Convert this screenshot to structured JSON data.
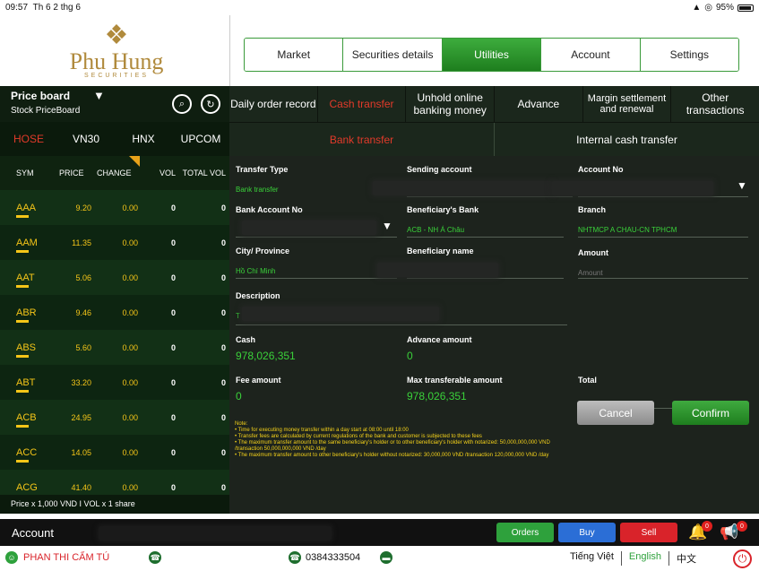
{
  "status_bar": {
    "time": "09:57",
    "date": "Th 6 2 thg 6",
    "battery": "95%"
  },
  "logo": {
    "name": "Phu Hung",
    "tagline": "SECURITIES"
  },
  "top_nav": [
    "Market",
    "Securities details",
    "Utilities",
    "Account",
    "Settings"
  ],
  "price_board": {
    "title": "Price board",
    "subtitle": "Stock PriceBoard",
    "exchanges": [
      "HOSE",
      "VN30",
      "HNX",
      "UPCOM"
    ],
    "columns": [
      "SYM",
      "PRICE",
      "CHANGE",
      "VOL",
      "TOTAL VOL"
    ],
    "rows": [
      {
        "sym": "AAA",
        "price": "9.20",
        "change": "0.00",
        "vol": "0",
        "total": "0"
      },
      {
        "sym": "AAM",
        "price": "11.35",
        "change": "0.00",
        "vol": "0",
        "total": "0"
      },
      {
        "sym": "AAT",
        "price": "5.06",
        "change": "0.00",
        "vol": "0",
        "total": "0"
      },
      {
        "sym": "ABR",
        "price": "9.46",
        "change": "0.00",
        "vol": "0",
        "total": "0"
      },
      {
        "sym": "ABS",
        "price": "5.60",
        "change": "0.00",
        "vol": "0",
        "total": "0"
      },
      {
        "sym": "ABT",
        "price": "33.20",
        "change": "0.00",
        "vol": "0",
        "total": "0"
      },
      {
        "sym": "ACB",
        "price": "24.95",
        "change": "0.00",
        "vol": "0",
        "total": "0"
      },
      {
        "sym": "ACC",
        "price": "14.05",
        "change": "0.00",
        "vol": "0",
        "total": "0"
      },
      {
        "sym": "ACG",
        "price": "41.40",
        "change": "0.00",
        "vol": "0",
        "total": "0"
      }
    ],
    "footer": "Price x 1,000 VND I VOL x 1 share"
  },
  "utility_tabs": [
    {
      "label": "Daily order record",
      "active": false
    },
    {
      "label": "Cash transfer",
      "active": true
    },
    {
      "label": "Unhold online banking money",
      "active": false
    },
    {
      "label": "Advance",
      "active": false
    },
    {
      "label": "Margin settlement and renewal",
      "active": false
    },
    {
      "label": "Other transactions",
      "active": false
    }
  ],
  "transfer_tabs": [
    "Bank transfer",
    "Internal cash transfer"
  ],
  "form": {
    "transfer_type": {
      "label": "Transfer Type",
      "value": "Bank transfer"
    },
    "sending_account": {
      "label": "Sending account"
    },
    "account_no": {
      "label": "Account No"
    },
    "bank_account_no": {
      "label": "Bank Account No"
    },
    "beneficiary_bank": {
      "label": "Beneficiary's Bank",
      "value": "ACB - NH Á Châu"
    },
    "branch": {
      "label": "Branch",
      "value": "NHTMCP A CHAU-CN TPHCM"
    },
    "city": {
      "label": "City/ Province",
      "value": "Hồ Chí Minh"
    },
    "beneficiary_name": {
      "label": "Beneficiary name"
    },
    "amount": {
      "label": "Amount",
      "placeholder": "Amount"
    },
    "description": {
      "label": "Description",
      "value": "T"
    },
    "cash": {
      "label": "Cash",
      "value": "978,026,351"
    },
    "advance_amount": {
      "label": "Advance amount",
      "value": "0"
    },
    "fee_amount": {
      "label": "Fee amount",
      "value": "0"
    },
    "max_transferable": {
      "label": "Max transferable amount",
      "value": "978,026,351"
    },
    "total": {
      "label": "Total"
    }
  },
  "notes": [
    "Note:",
    "• Time for executing money transfer within a day start at 08:00 until 18:00",
    "• Transfer fees are calculated by current regulations of the bank and customer is subjected to these fees",
    "• The maximum transfer amount to the same beneficiary's holder or to other beneficiary's holder with notarized: 50,000,000,000 VND /transaction 50,000,000,000 VND /day",
    "• The maximum transfer amount to other beneficiary's holder without notarized: 30,000,000 VND /transaction 120,000,000 VND /day"
  ],
  "buttons": {
    "cancel": "Cancel",
    "confirm": "Confirm"
  },
  "account_bar": {
    "label": "Account",
    "orders": "Orders",
    "buy": "Buy",
    "sell": "Sell",
    "notification_count": "0",
    "announcement_count": "0"
  },
  "footer": {
    "user_name": "PHAN THI CẨM TÚ",
    "phone": "0384333504",
    "languages": [
      "Tiếng Việt",
      "English",
      "中文"
    ],
    "active_language": "English"
  },
  "colors": {
    "accent_green": "#2ea13c",
    "active_red": "#e23a2a",
    "value_yellow": "#f5c518",
    "value_green": "#3ad13a"
  }
}
